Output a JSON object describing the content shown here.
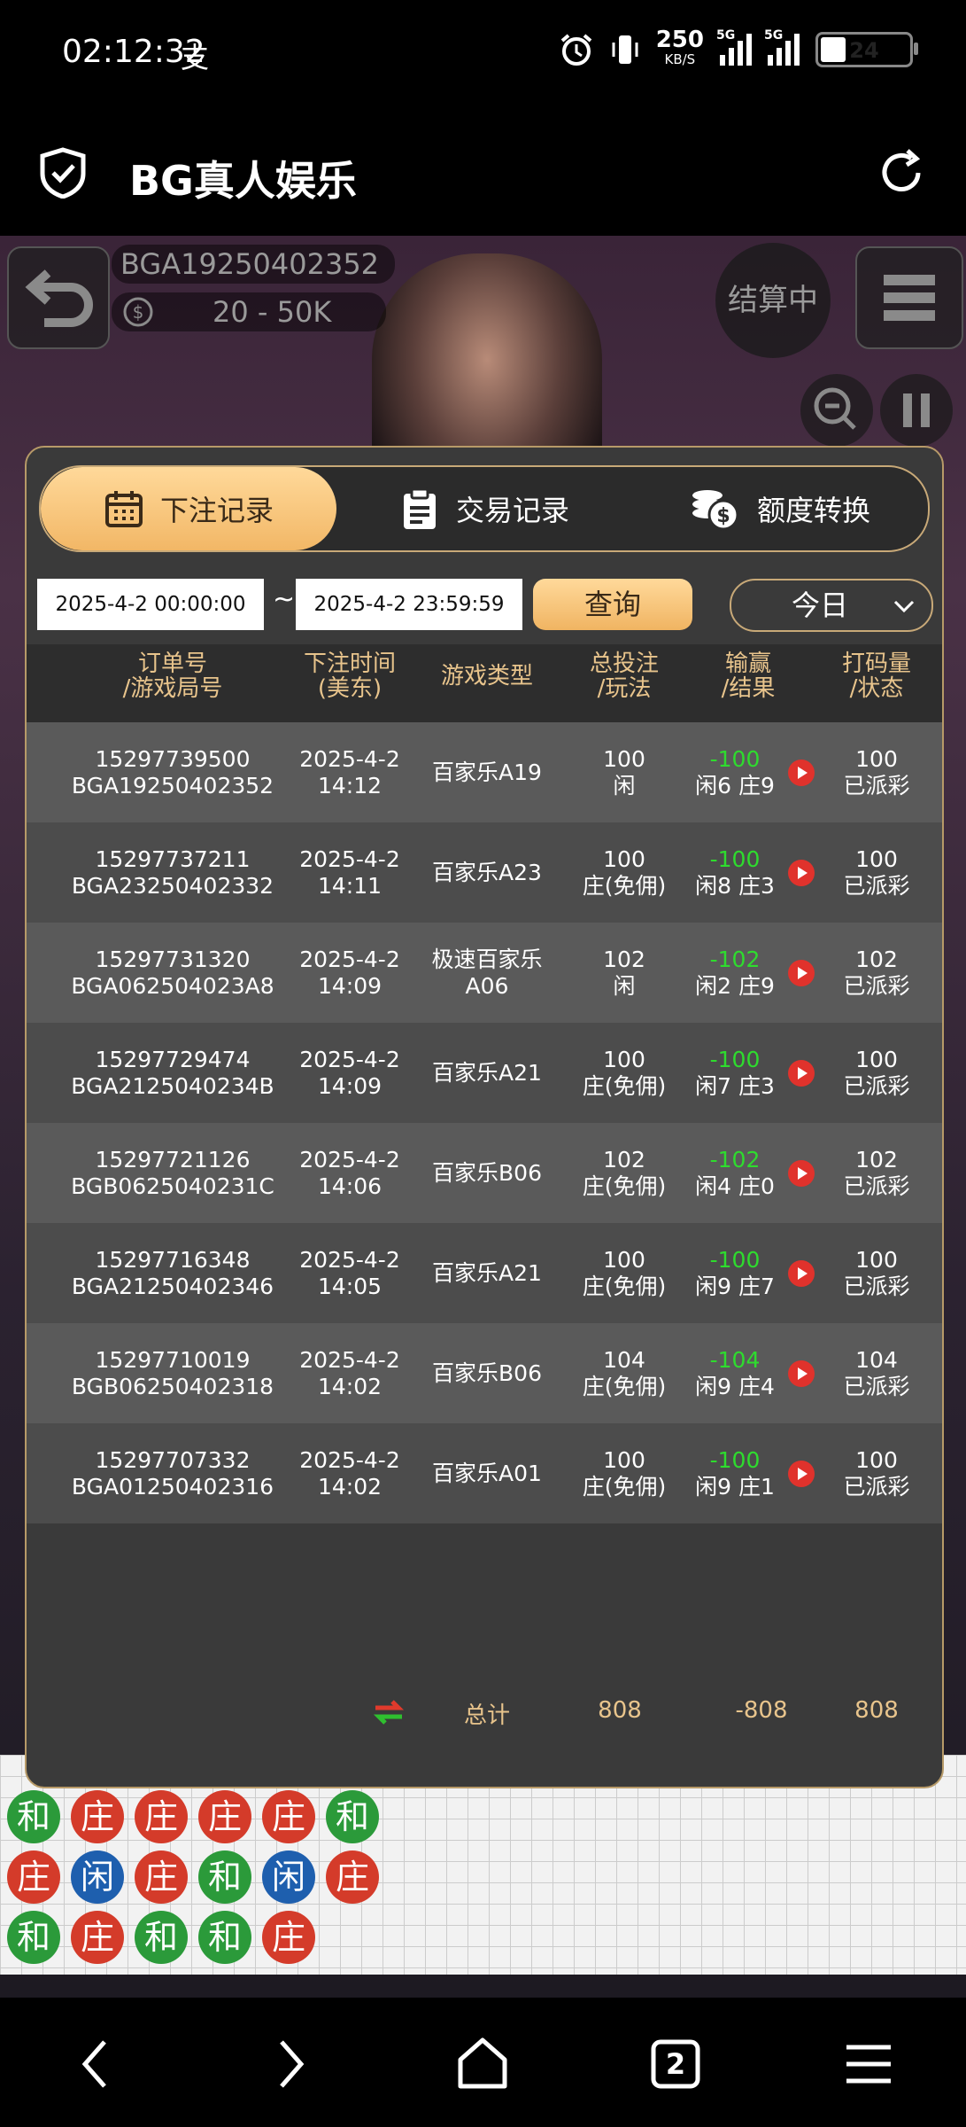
{
  "status_bar": {
    "time": "02:12:32",
    "speed_value": "250",
    "speed_unit": "KB/S",
    "sim1_label": "5G",
    "sim2_label": "5G",
    "battery": "24"
  },
  "browser": {
    "title": "BG真人娱乐"
  },
  "game": {
    "table_code": "BGA19250402352",
    "limits": "20 - 50K",
    "settle_status": "结算中"
  },
  "panel": {
    "tabs": [
      {
        "label": "下注记录",
        "icon": "calendar-icon",
        "active": true
      },
      {
        "label": "交易记录",
        "icon": "clipboard-icon",
        "active": false
      },
      {
        "label": "额度转换",
        "icon": "coins-icon",
        "active": false
      }
    ],
    "filters": {
      "start_datetime": "2025-4-2 00:00:00",
      "separator": "~",
      "end_datetime": "2025-4-2 23:59:59",
      "query_label": "查询",
      "day_select": "今日"
    },
    "headers": [
      [
        "订单号",
        "/游戏局号"
      ],
      [
        "下注时间",
        "(美东)"
      ],
      [
        "游戏类型",
        ""
      ],
      [
        "总投注",
        "/玩法"
      ],
      [
        "输赢",
        "/结果"
      ],
      [
        "打码量",
        "/状态"
      ]
    ],
    "rows": [
      {
        "order": "15297739500",
        "round": "BGA19250402352",
        "date": "2025-4-2",
        "time": "14:12",
        "game": "百家乐A19",
        "game2": "",
        "bet": "100",
        "play": "闲",
        "winloss": "-100",
        "result": "闲6 庄9",
        "turnover": "100",
        "status": "已派彩"
      },
      {
        "order": "15297737211",
        "round": "BGA23250402332",
        "date": "2025-4-2",
        "time": "14:11",
        "game": "百家乐A23",
        "game2": "",
        "bet": "100",
        "play": "庄(免佣)",
        "winloss": "-100",
        "result": "闲8 庄3",
        "turnover": "100",
        "status": "已派彩"
      },
      {
        "order": "15297731320",
        "round": "BGA062504023A8",
        "date": "2025-4-2",
        "time": "14:09",
        "game": "极速百家乐",
        "game2": "A06",
        "bet": "102",
        "play": "闲",
        "winloss": "-102",
        "result": "闲2 庄9",
        "turnover": "102",
        "status": "已派彩"
      },
      {
        "order": "15297729474",
        "round": "BGA2125040234B",
        "date": "2025-4-2",
        "time": "14:09",
        "game": "百家乐A21",
        "game2": "",
        "bet": "100",
        "play": "庄(免佣)",
        "winloss": "-100",
        "result": "闲7 庄3",
        "turnover": "100",
        "status": "已派彩"
      },
      {
        "order": "15297721126",
        "round": "BGB0625040231C",
        "date": "2025-4-2",
        "time": "14:06",
        "game": "百家乐B06",
        "game2": "",
        "bet": "102",
        "play": "庄(免佣)",
        "winloss": "-102",
        "result": "闲4 庄0",
        "turnover": "102",
        "status": "已派彩"
      },
      {
        "order": "15297716348",
        "round": "BGA21250402346",
        "date": "2025-4-2",
        "time": "14:05",
        "game": "百家乐A21",
        "game2": "",
        "bet": "100",
        "play": "庄(免佣)",
        "winloss": "-100",
        "result": "闲9 庄7",
        "turnover": "100",
        "status": "已派彩"
      },
      {
        "order": "15297710019",
        "round": "BGB06250402318",
        "date": "2025-4-2",
        "time": "14:02",
        "game": "百家乐B06",
        "game2": "",
        "bet": "104",
        "play": "庄(免佣)",
        "winloss": "-104",
        "result": "闲9 庄4",
        "turnover": "104",
        "status": "已派彩"
      },
      {
        "order": "15297707332",
        "round": "BGA01250402316",
        "date": "2025-4-2",
        "time": "14:02",
        "game": "百家乐A01",
        "game2": "",
        "bet": "100",
        "play": "庄(免佣)",
        "winloss": "-100",
        "result": "闲9 庄1",
        "turnover": "100",
        "status": "已派彩"
      }
    ],
    "totals": {
      "label": "总计",
      "bet": "808",
      "winloss": "-808",
      "turnover": "808"
    }
  },
  "roadmap": {
    "beads": [
      [
        "和",
        "庄",
        "庄",
        "庄",
        "庄",
        "和"
      ],
      [
        "庄",
        "闲",
        "庄",
        "和",
        "闲",
        "庄"
      ],
      [
        "和",
        "庄",
        "和",
        "和",
        "庄"
      ]
    ]
  },
  "colors": {
    "gold": "#e8c48c",
    "win_green": "#2edc2e",
    "banker_red": "#d43b2a",
    "player_blue": "#1e5fae",
    "tie_green": "#2b9a3a"
  }
}
